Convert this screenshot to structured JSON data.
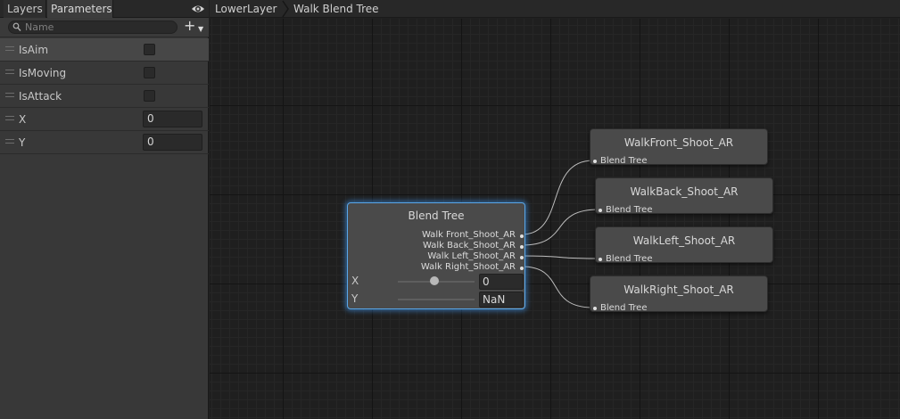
{
  "tabs": {
    "layers": "Layers",
    "parameters": "Parameters"
  },
  "search": {
    "placeholder": "Name"
  },
  "parameters": [
    {
      "name": "IsAim",
      "type": "bool"
    },
    {
      "name": "IsMoving",
      "type": "bool"
    },
    {
      "name": "IsAttack",
      "type": "bool"
    },
    {
      "name": "X",
      "type": "float",
      "value": "0"
    },
    {
      "name": "Y",
      "type": "float",
      "value": "0"
    }
  ],
  "breadcrumb": {
    "layer": "LowerLayer",
    "state": "Walk Blend Tree"
  },
  "blend_tree": {
    "title": "Blend Tree",
    "motions": [
      "Walk Front_Shoot_AR",
      "Walk Back_Shoot_AR",
      "Walk Left_Shoot_AR",
      "Walk Right_Shoot_AR"
    ],
    "x_label": "X",
    "x_value": "0",
    "y_label": "Y",
    "y_value": "NaN"
  },
  "motion_nodes": [
    {
      "title": "WalkFront_Shoot_AR",
      "input_label": "Blend Tree"
    },
    {
      "title": "WalkBack_Shoot_AR",
      "input_label": "Blend Tree"
    },
    {
      "title": "WalkLeft_Shoot_AR",
      "input_label": "Blend Tree"
    },
    {
      "title": "WalkRight_Shoot_AR",
      "input_label": "Blend Tree"
    }
  ],
  "colors": {
    "selection_glow": "#5aa7e8",
    "panel": "#383838",
    "graph": "#1f1f1f"
  }
}
